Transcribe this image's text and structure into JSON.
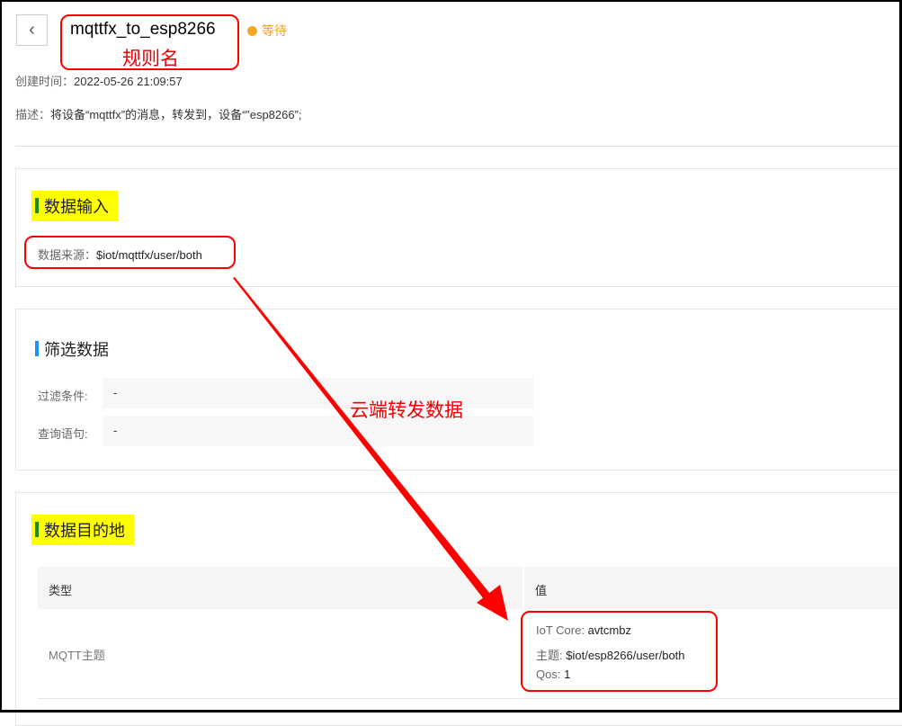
{
  "header": {
    "back_icon": "chevron-left-icon",
    "title": "mqttfx_to_esp8266",
    "annotation": "规则名",
    "status": "等待",
    "status_color": "#f5a623"
  },
  "meta": {
    "created_label": "创建时间：",
    "created_value": "2022-05-26 21:09:57",
    "desc_label": "描述：",
    "desc_value": "将设备“mqttfx”的消息，转发到，设备“”esp8266”;"
  },
  "input": {
    "title": "数据输入",
    "source_label": "数据来源：",
    "source_value": "$iot/mqttfx/user/both"
  },
  "filter": {
    "title": "筛选数据",
    "condition_label": "过滤条件:",
    "condition_value": "-",
    "query_label": "查询语句:",
    "query_value": "-"
  },
  "annotation_arrow": "云端转发数据",
  "destination": {
    "title": "数据目的地",
    "columns": [
      "类型",
      "值"
    ],
    "rows": [
      {
        "type": "MQTT主题",
        "iot_label": "IoT Core:",
        "iot_value": "avtcmbz",
        "topic_label": "主题:",
        "topic_value": "$iot/esp8266/user/both",
        "qos_label": "Qos:",
        "qos_value": "1"
      }
    ]
  }
}
